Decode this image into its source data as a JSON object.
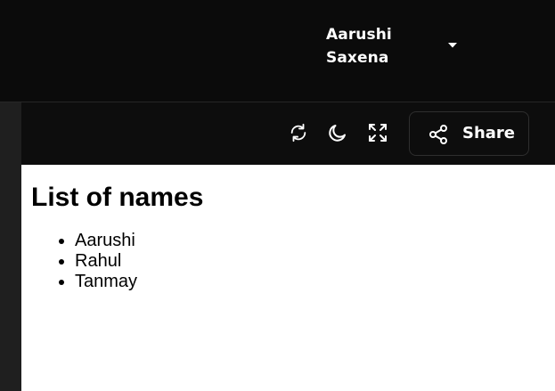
{
  "header": {
    "user_name": "Aarushi Saxena",
    "user_menu_icon": "caret-down-icon"
  },
  "toolbar": {
    "refresh_icon": "refresh-icon",
    "theme_icon": "moon-icon",
    "fullscreen_icon": "expand-icon",
    "share_icon": "share-icon",
    "share_label": "Share"
  },
  "preview": {
    "heading": "List of names",
    "names": [
      "Aarushi",
      "Rahul",
      "Tanmay"
    ]
  },
  "colors": {
    "background": "#0b0b0b",
    "toolbar": "#0d0d0d",
    "sidebar": "#1f1f1f",
    "text_light": "#ffffff",
    "preview_bg": "#ffffff"
  }
}
